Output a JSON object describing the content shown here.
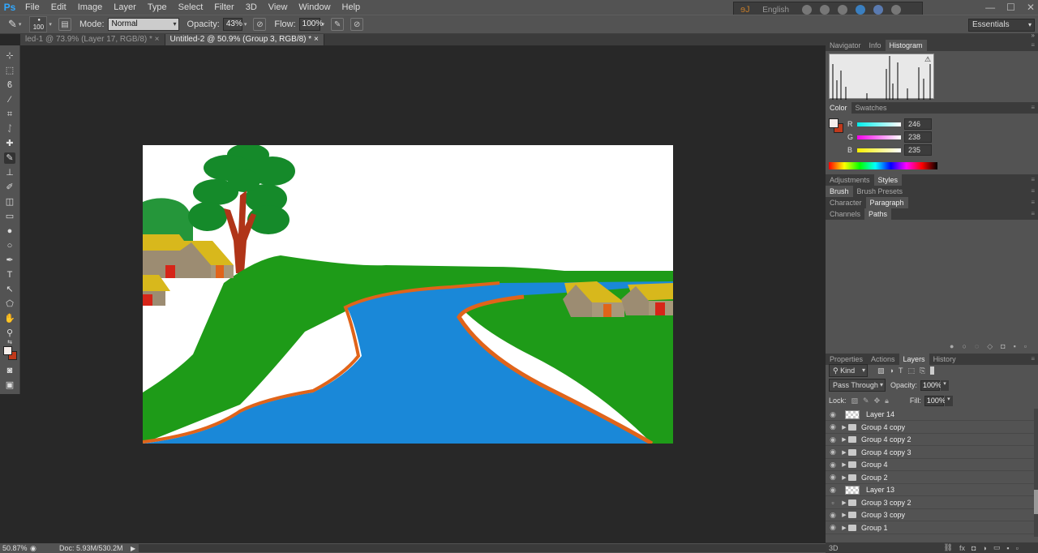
{
  "app": {
    "logo": "Ps"
  },
  "menu": [
    "File",
    "Edit",
    "Image",
    "Layer",
    "Type",
    "Select",
    "Filter",
    "3D",
    "View",
    "Window",
    "Help"
  ],
  "language": {
    "label": "English"
  },
  "window_controls": [
    "—",
    "☐",
    "✕"
  ],
  "options_bar": {
    "brush_size": "100",
    "mode_label": "Mode:",
    "mode_value": "Normal",
    "opacity_label": "Opacity:",
    "opacity_value": "43%",
    "flow_label": "Flow:",
    "flow_value": "100%"
  },
  "workspace": "Essentials",
  "tabs": [
    {
      "label": "led-1 @ 73.9% (Layer 17, RGB/8) *",
      "active": false
    },
    {
      "label": "Untitled-2 @ 50.9% (Group 3, RGB/8) *",
      "active": true
    }
  ],
  "status": {
    "zoom": "50.87%",
    "doc": "Doc: 5.93M/530.2M"
  },
  "panels": {
    "navigator_tabs": [
      "Navigator",
      "Info",
      "Histogram"
    ],
    "color_tabs": [
      "Color",
      "Swatches"
    ],
    "color": {
      "r_label": "R",
      "r_value": "246",
      "g_label": "G",
      "g_value": "238",
      "b_label": "B",
      "b_value": "235",
      "foreground": "#f6eeeb",
      "background": "#c0391b"
    },
    "adjustments_tabs": [
      "Adjustments",
      "Styles"
    ],
    "brush_tabs": [
      "Brush",
      "Brush Presets"
    ],
    "character_tabs": [
      "Character",
      "Paragraph"
    ],
    "channels_tabs": [
      "Channels",
      "Paths"
    ],
    "layers_tabs": [
      "Properties",
      "Actions",
      "Layers",
      "History"
    ],
    "layers": {
      "kind_label": "Kind",
      "blend_mode": "Pass Through",
      "opacity_label": "Opacity:",
      "opacity_value": "100%",
      "lock_label": "Lock:",
      "fill_label": "Fill:",
      "fill_value": "100%",
      "items": [
        {
          "name": "Layer 14",
          "type": "layer",
          "visible": true
        },
        {
          "name": "Group 4 copy",
          "type": "group",
          "visible": true
        },
        {
          "name": "Group 4 copy 2",
          "type": "group",
          "visible": true
        },
        {
          "name": "Group 4 copy 3",
          "type": "group",
          "visible": true
        },
        {
          "name": "Group 4",
          "type": "group",
          "visible": true
        },
        {
          "name": "Group 2",
          "type": "group",
          "visible": true
        },
        {
          "name": "Layer 13",
          "type": "layer",
          "visible": true
        },
        {
          "name": "Group 3 copy 2",
          "type": "group",
          "visible": false
        },
        {
          "name": "Group 3 copy",
          "type": "group",
          "visible": true
        },
        {
          "name": "Group 1",
          "type": "group",
          "visible": true
        }
      ]
    },
    "bottom_tab": "3D"
  }
}
